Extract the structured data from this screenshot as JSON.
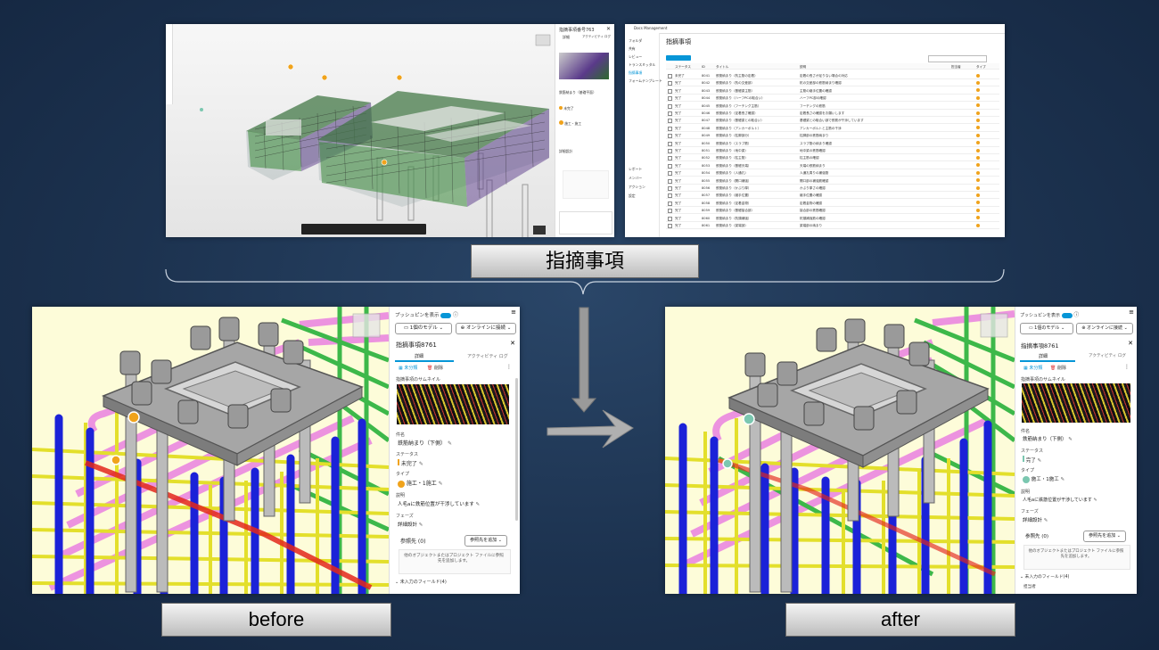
{
  "labels": {
    "main": "指摘事項",
    "before": "before",
    "after": "after"
  },
  "top_left": {
    "panel_title": "指摘事項番号763",
    "tab_details": "詳細",
    "tab_activity": "アクティビティ ログ",
    "issue_name": "鉄筋納まり（基礎平面）",
    "status": "未完了",
    "type": "施工・施工",
    "phase": "詳細設計"
  },
  "top_right": {
    "app": "Docs Management",
    "page_title": "指摘事項",
    "sidebar": [
      "フォルダ",
      "共有",
      "レビュー",
      "トランスミッタル",
      "指摘事項",
      "フォームテンプレート",
      "レポート",
      "メンバー",
      "アクション",
      "設定"
    ],
    "columns": [
      "ステータス",
      "ID",
      "タイトル",
      "説明",
      "担当者",
      "タイプ"
    ],
    "rows": [
      {
        "status": "未完了",
        "id": "8041",
        "title": "鉄筋納まり（杭主筋の定着）",
        "desc": "定着の長さが足りない場合の対応"
      },
      {
        "status": "完了",
        "id": "8042",
        "title": "鉄筋納まり（杭の交差部）",
        "desc": "杭の交差部の鉄筋納まり確認"
      },
      {
        "status": "完了",
        "id": "8043",
        "title": "鉄筋納まり（基礎梁主筋）",
        "desc": "主筋の継手位置の確認"
      },
      {
        "status": "完了",
        "id": "8044",
        "title": "鉄筋納まり（ハーフPCの取合い）",
        "desc": "ハーフPC部の確認"
      },
      {
        "status": "完了",
        "id": "8045",
        "title": "鉄筋納まり（フーチング主筋）",
        "desc": "フーチングの鉄筋"
      },
      {
        "status": "完了",
        "id": "8046",
        "title": "鉄筋納まり（定着長さ確認）",
        "desc": "定着長さの確認をお願いします"
      },
      {
        "status": "完了",
        "id": "8047",
        "title": "鉄筋納まり（基礎梁との取合い）",
        "desc": "基礎梁との取合い部で鉄筋が干渉しています"
      },
      {
        "status": "完了",
        "id": "8048",
        "title": "鉄筋納まり（アンカーボルト）",
        "desc": "アンカーボルトと主筋の干渉"
      },
      {
        "status": "完了",
        "id": "8049",
        "title": "鉄筋納まり（柱脚部分）",
        "desc": "柱脚部の鉄筋納まり"
      },
      {
        "status": "完了",
        "id": "8050",
        "title": "鉄筋納まり（スラブ筋）",
        "desc": "スラブ筋の納まり確認"
      },
      {
        "status": "完了",
        "id": "8051",
        "title": "鉄筋納まり（地中梁）",
        "desc": "地中梁の鉄筋確認"
      },
      {
        "status": "完了",
        "id": "8052",
        "title": "鉄筋納まり（柱主筋）",
        "desc": "柱主筋の確認"
      },
      {
        "status": "完了",
        "id": "8053",
        "title": "鉄筋納まり（基礎天端）",
        "desc": "天端の鉄筋納まり"
      },
      {
        "status": "完了",
        "id": "8054",
        "title": "鉄筋納まり（人通孔）",
        "desc": "人通孔周りの補強筋"
      },
      {
        "status": "完了",
        "id": "8055",
        "title": "鉄筋納まり（開口補強）",
        "desc": "開口部の補強筋確認"
      },
      {
        "status": "完了",
        "id": "8056",
        "title": "鉄筋納まり（かぶり厚）",
        "desc": "かぶり厚さの確認"
      },
      {
        "status": "完了",
        "id": "8057",
        "title": "鉄筋納まり（継手位置）",
        "desc": "継手位置の確認"
      },
      {
        "status": "完了",
        "id": "8058",
        "title": "鉄筋納まり（定着金物）",
        "desc": "定着金物の確認"
      },
      {
        "status": "完了",
        "id": "8059",
        "title": "鉄筋納まり（基礎接合部）",
        "desc": "接合部の鉄筋確認"
      },
      {
        "status": "完了",
        "id": "8060",
        "title": "鉄筋納まり（杭頭補強）",
        "desc": "杭頭補強筋の確認"
      },
      {
        "status": "完了",
        "id": "8061",
        "title": "鉄筋納まり（梁端部）",
        "desc": "梁端部の納まり"
      }
    ]
  },
  "before_panel": {
    "bubble_toggle": "プッシュピンを表示",
    "model_dropdown": "1個のモデル",
    "online_dropdown": "オンラインに接続",
    "issue_title": "指摘事項8761",
    "tab_details": "詳細",
    "tab_activity": "アクティビティ ログ",
    "action_unsolved": "未分類",
    "action_delete": "削除",
    "thumb_label": "指摘事項のサムネイル",
    "name_label": "件名",
    "name_value": "鉄筋納まり（下側）",
    "status_label": "ステータス",
    "status_value": "未完了",
    "type_label": "タイプ",
    "type_value": "施工・1施工",
    "desc_label": "説明",
    "desc_value": "人毛aに鉄筋位置が干渉しています",
    "phase_label": "フェーズ",
    "phase_value": "詳細設計",
    "ref_label": "参照先 (0)",
    "ref_button": "参照先を追加",
    "ref_hint": "他のオブジェクトまたはプロジェクト ファイルに参照先を追加します。",
    "fields_label": "未入力のフィールド(4)"
  },
  "after_panel": {
    "bubble_toggle": "プッシュピンを表示",
    "model_dropdown": "1個のモデル",
    "online_dropdown": "オンラインに接続",
    "issue_title": "指摘事項8761",
    "tab_details": "詳細",
    "tab_activity": "アクティビティ ログ",
    "action_unsolved": "未分類",
    "action_delete": "削除",
    "thumb_label": "指摘事項のサムネイル",
    "name_label": "件名",
    "name_value": "鉄筋納まり（下側）",
    "status_label": "ステータス",
    "status_value": "完了",
    "type_label": "タイプ",
    "type_value": "施工・1施工",
    "desc_label": "説明",
    "desc_value": "人毛aに鉄筋位置が干渉しています",
    "phase_label": "フェーズ",
    "phase_value": "詳細設計",
    "ref_label": "参照先 (0)",
    "ref_button": "参照先を追加",
    "ref_hint": "他のオブジェクトまたはプロジェクト ファイルに参照先を追加します。",
    "fields_label": "未入力のフィールド(4)",
    "last_field": "担当者"
  },
  "colors": {
    "status_open": "#f0a31c",
    "status_done": "#7bc7b0",
    "accent": "#0696d7"
  }
}
